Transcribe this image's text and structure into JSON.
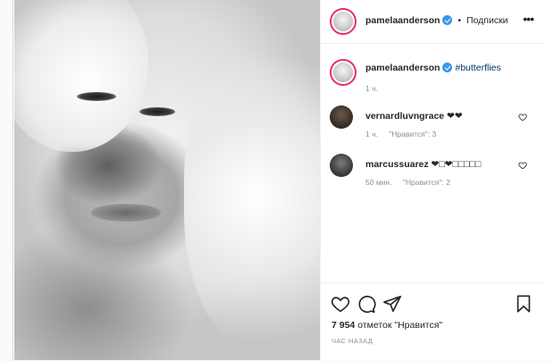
{
  "post": {
    "author": "pamelaanderson",
    "follow_state": "Подписки",
    "separator": "•",
    "more_label": "•••"
  },
  "caption": {
    "author": "pamelaanderson",
    "hashtag": "#butterflies",
    "time": "1 ч."
  },
  "comments": [
    {
      "author": "vernardluvngrace",
      "text": "❤❤",
      "time": "1 ч.",
      "likes": "\"Нравится\": 3"
    },
    {
      "author": "marcussuarez",
      "text": "❤□❤□□□□□",
      "time": "50 мин.",
      "likes": "\"Нравится\": 2"
    }
  ],
  "footer": {
    "likes_count": "7 954",
    "likes_label": "отметок \"Нравится\"",
    "when": "ЧАС НАЗАД"
  },
  "colors": {
    "verified": "#3897f0",
    "story_ring": "#e1306c",
    "hashtag": "#003569",
    "muted": "#8e8e8e"
  },
  "icons": [
    "heart-icon",
    "comment-icon",
    "share-icon",
    "bookmark-icon",
    "verified-icon",
    "more-icon"
  ]
}
